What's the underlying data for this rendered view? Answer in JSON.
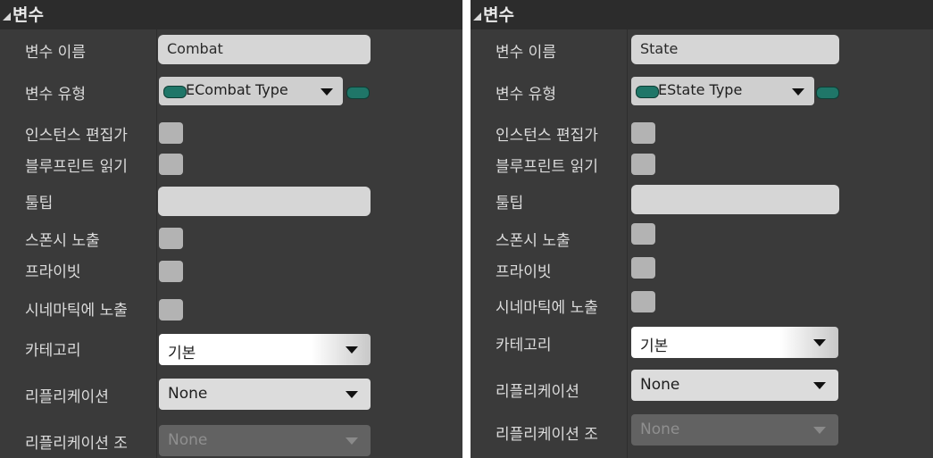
{
  "panels": [
    {
      "section_title": "변수",
      "labels": {
        "var_name": "변수 이름",
        "var_type": "변수 유형",
        "instance_editable": "인스턴스 편집가",
        "blueprint_readonly": "블루프린트 읽기",
        "tooltip": "툴팁",
        "expose_on_spawn": "스폰시 노출",
        "private": "프라이빗",
        "expose_cinematics": "시네마틱에 노출",
        "category": "카테고리",
        "replication": "리플리케이션",
        "replication_condition": "리플리케이션 조"
      },
      "values": {
        "var_name": "Combat",
        "var_type": "ECombat Type",
        "tooltip": "",
        "category": "기본",
        "replication": "None",
        "replication_condition": "None"
      },
      "checkboxes": {
        "instance_editable": false,
        "blueprint_readonly": false,
        "expose_on_spawn": false,
        "private": false,
        "expose_cinematics": false
      }
    },
    {
      "section_title": "변수",
      "labels": {
        "var_name": "변수 이름",
        "var_type": "변수 유형",
        "instance_editable": "인스턴스 편집가",
        "blueprint_readonly": "블루프린트 읽기",
        "tooltip": "툴팁",
        "expose_on_spawn": "스폰시 노출",
        "private": "프라이빗",
        "expose_cinematics": "시네마틱에 노출",
        "category": "카테고리",
        "replication": "리플리케이션",
        "replication_condition": "리플리케이션 조"
      },
      "values": {
        "var_name": "State",
        "var_type": "EState Type",
        "tooltip": "",
        "category": "기본",
        "replication": "None",
        "replication_condition": "None"
      },
      "checkboxes": {
        "instance_editable": false,
        "blueprint_readonly": false,
        "expose_on_spawn": false,
        "private": false,
        "expose_cinematics": false
      }
    }
  ],
  "icons": {
    "collapse": "collapse-triangle-icon",
    "enum_pin": "enum-pin-icon",
    "dropdown": "chevron-down-icon"
  },
  "colors": {
    "panel_bg": "#3a3a3a",
    "header_bg": "#2c2c2c",
    "enum_pin": "#1f7668",
    "checkbox": "#b3b3b3"
  }
}
